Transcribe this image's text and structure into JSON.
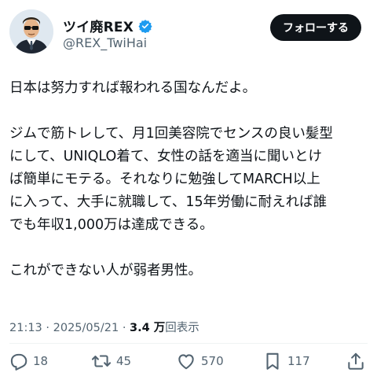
{
  "author": {
    "display_name": "ツイ廃REX",
    "handle": "@REX_TwiHai",
    "verified": true
  },
  "follow_button": "フォローする",
  "post": {
    "lines_block1": [
      "日本は努力すれば報われる国なんだよ。"
    ],
    "lines_block2": [
      "ジムで筋トレして、月1回美容院でセンスの良い髪型",
      "にして、UNIQLO着て、女性の話を適当に聞いとけ",
      "ば簡単にモテる。それなりに勉強してMARCH以上",
      "に入って、大手に就職して、15年労働に耐えれば誰",
      "でも年収1,000万は達成できる。"
    ],
    "lines_block3": [
      "これができない人が弱者男性。"
    ]
  },
  "meta": {
    "time": "21:13",
    "separator": "·",
    "date": "2025/05/21",
    "views_count": "3.4 万",
    "views_label": "回表示"
  },
  "stats": {
    "replies": "18",
    "reposts": "45",
    "likes": "570",
    "bookmarks": "117"
  },
  "colors": {
    "text": "#0f1419",
    "secondary": "#536471",
    "verified_blue": "#1d9bf0",
    "follow_bg": "#0f1419"
  },
  "icons": [
    "reply-icon",
    "repost-icon",
    "like-icon",
    "bookmark-icon",
    "share-icon",
    "verified-badge-icon"
  ]
}
